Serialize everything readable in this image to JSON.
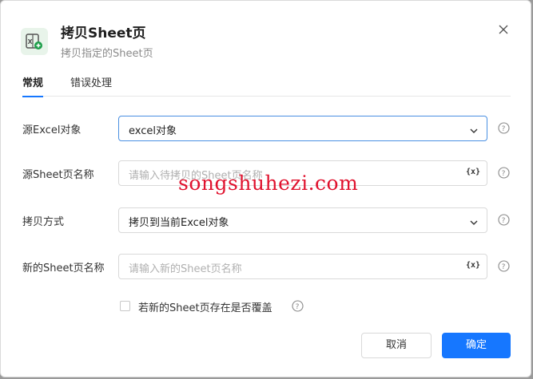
{
  "dialog": {
    "icon": "excel-copy-icon",
    "title": "拷贝Sheet页",
    "subtitle": "拷贝指定的Sheet页"
  },
  "tabs": [
    {
      "label": "常规",
      "active": true
    },
    {
      "label": "错误处理",
      "active": false
    }
  ],
  "form": {
    "source_excel": {
      "label": "源Excel对象",
      "value": "excel对象"
    },
    "source_sheet": {
      "label": "源Sheet页名称",
      "placeholder": "请输入待拷贝的Sheet页名称",
      "var_icon": "{x}"
    },
    "copy_mode": {
      "label": "拷贝方式",
      "value": "拷贝到当前Excel对象"
    },
    "new_sheet": {
      "label": "新的Sheet页名称",
      "placeholder": "请输入新的Sheet页名称",
      "var_icon": "{x}"
    },
    "overwrite": {
      "label": "若新的Sheet页存在是否覆盖",
      "checked": false
    }
  },
  "buttons": {
    "cancel": "取消",
    "ok": "确定"
  },
  "watermark": "songshuhezi.com",
  "colors": {
    "accent": "#1677ff",
    "icon_bg": "#e8f4ea",
    "icon_green": "#1e9e4a",
    "watermark": "#e0122e"
  }
}
